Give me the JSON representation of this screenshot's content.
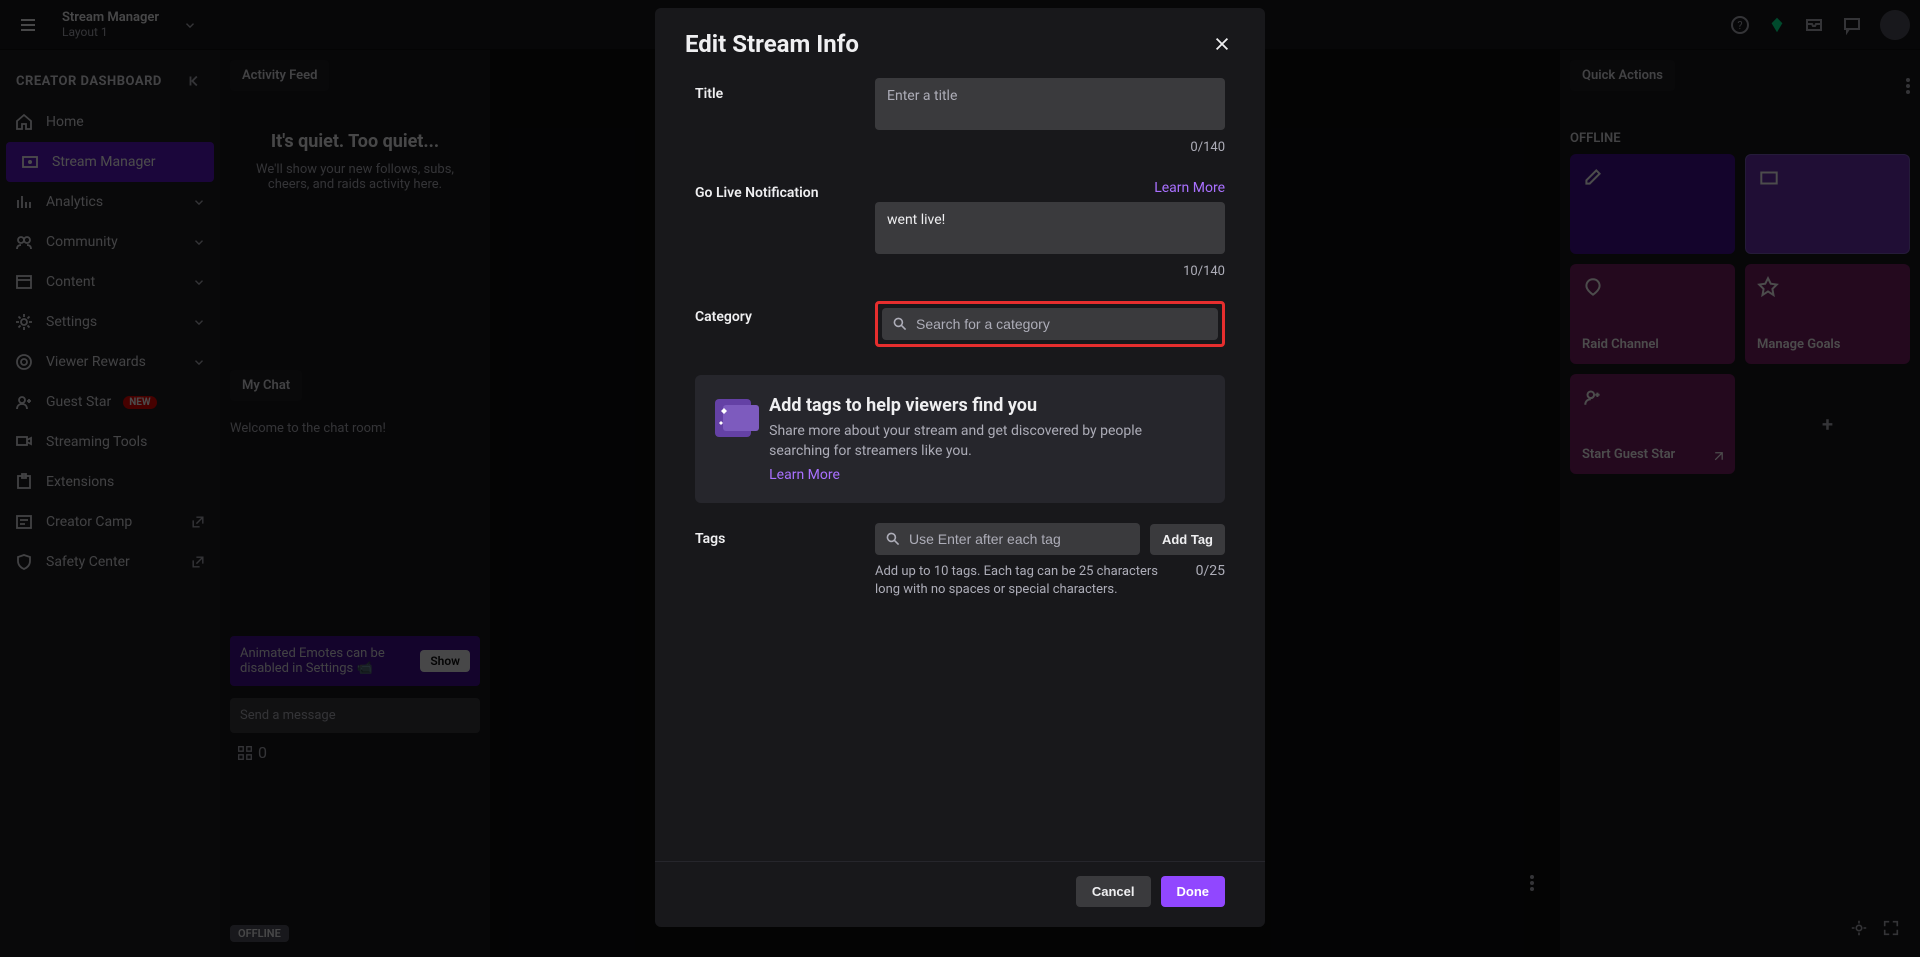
{
  "topnav": {
    "title": "Stream Manager",
    "subtitle": "Layout 1"
  },
  "sidebar": {
    "header": "CREATOR DASHBOARD",
    "items": [
      {
        "label": "Home",
        "icon": "home",
        "active": false
      },
      {
        "label": "Stream Manager",
        "icon": "stream",
        "active": true
      },
      {
        "label": "Analytics",
        "icon": "analytics",
        "expandable": true
      },
      {
        "label": "Community",
        "icon": "community",
        "expandable": true
      },
      {
        "label": "Content",
        "icon": "content",
        "expandable": true
      },
      {
        "label": "Settings",
        "icon": "settings",
        "expandable": true
      },
      {
        "label": "Viewer Rewards",
        "icon": "rewards",
        "expandable": true
      },
      {
        "label": "Guest Star",
        "icon": "guest",
        "badge": "NEW"
      },
      {
        "label": "Streaming Tools",
        "icon": "tools"
      },
      {
        "label": "Extensions",
        "icon": "extensions"
      },
      {
        "label": "Creator Camp",
        "icon": "camp",
        "external": true
      },
      {
        "label": "Safety Center",
        "icon": "safety",
        "external": true
      }
    ]
  },
  "activity": {
    "header": "Activity Feed",
    "quiet_title": "It's quiet. Too quiet...",
    "quiet_body": "We'll show your new follows, subs, cheers, and raids activity here."
  },
  "chat": {
    "header": "My Chat",
    "welcome": "Welcome to the chat room!",
    "tip_text": "Animated Emotes can be disabled in Settings 📹",
    "show_btn": "Show",
    "input_placeholder": "Send a message",
    "points": "0"
  },
  "quick": {
    "header": "Quick Actions",
    "offline_label": "OFFLINE",
    "cards": [
      {
        "label": "",
        "theme": "purple-dark"
      },
      {
        "label": "",
        "theme": "purple-light"
      },
      {
        "label": "Raid Channel",
        "theme": "magenta"
      },
      {
        "label": "Manage Goals",
        "theme": "magenta"
      },
      {
        "label": "Start Guest Star",
        "theme": "magenta"
      },
      {
        "label": "+",
        "theme": "plus"
      }
    ],
    "offline_pill": "OFFLINE"
  },
  "modal": {
    "title": "Edit Stream Info",
    "fields": {
      "title_label": "Title",
      "title_placeholder": "Enter a title",
      "title_count": "0/140",
      "golive_label": "Go Live Notification",
      "golive_learn": "Learn More",
      "golive_value": "went live!",
      "golive_count": "10/140",
      "category_label": "Category",
      "category_placeholder": "Search for a category",
      "tags_label": "Tags",
      "tags_placeholder": "Use Enter after each tag",
      "add_tag": "Add Tag",
      "tags_help": "Add up to 10 tags. Each tag can be 25 characters long with no spaces or special characters.",
      "tags_count": "0/25"
    },
    "info_box": {
      "title": "Add tags to help viewers find you",
      "body": "Share more about your stream and get discovered by people searching for streamers like you.",
      "learn": "Learn More"
    },
    "footer": {
      "cancel": "Cancel",
      "done": "Done"
    }
  }
}
